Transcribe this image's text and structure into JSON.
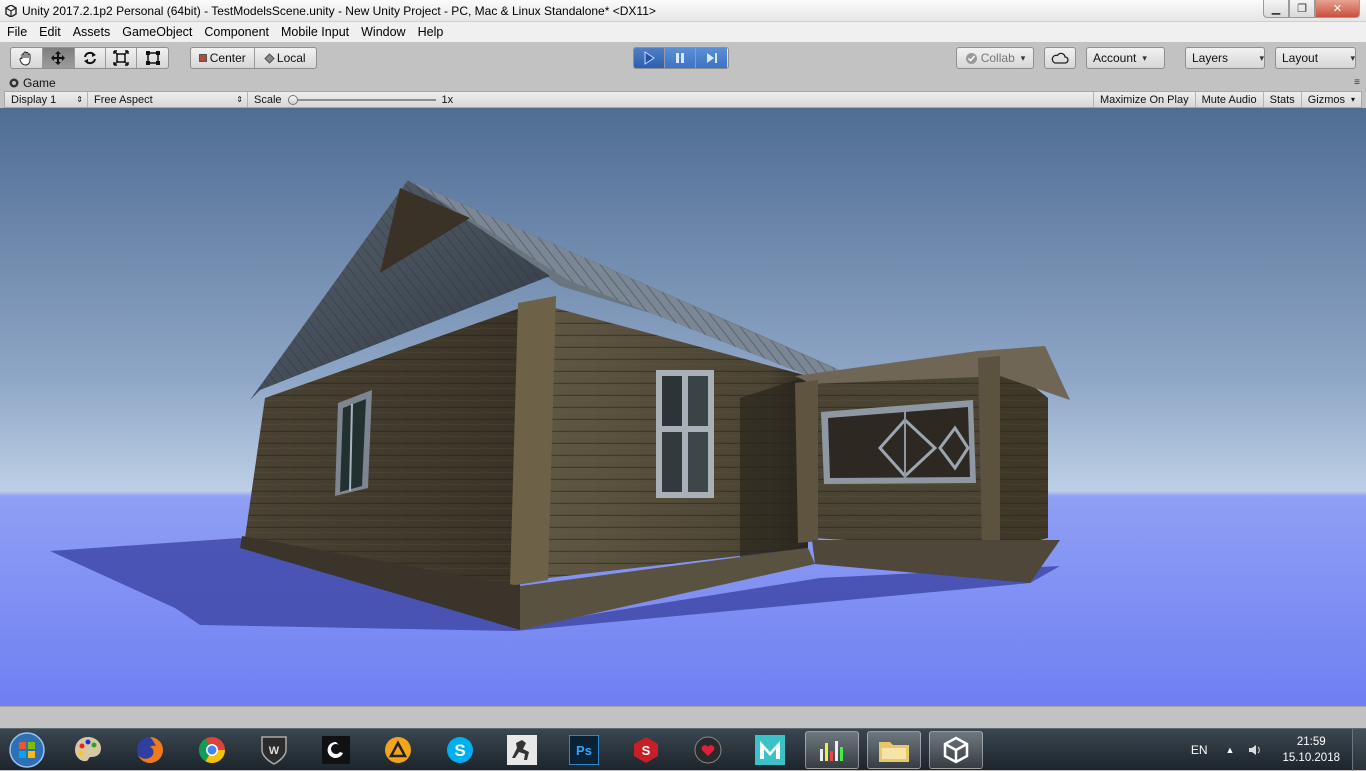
{
  "window": {
    "title": "Unity 2017.2.1p2 Personal (64bit) - TestModelsScene.unity - New Unity Project - PC, Mac & Linux Standalone* <DX11>"
  },
  "menu": [
    "File",
    "Edit",
    "Assets",
    "GameObject",
    "Component",
    "Mobile Input",
    "Window",
    "Help"
  ],
  "toolbar": {
    "pivot_label": "Center",
    "space_label": "Local",
    "collab_label": "Collab",
    "account_label": "Account",
    "layers_label": "Layers",
    "layout_label": "Layout"
  },
  "game_view": {
    "tab_label": "Game",
    "display_label": "Display 1",
    "aspect_label": "Free Aspect",
    "scale_label": "Scale",
    "scale_value": "1x",
    "maximize_label": "Maximize On Play",
    "mute_label": "Mute Audio",
    "stats_label": "Stats",
    "gizmos_label": "Gizmos"
  },
  "taskbar": {
    "apps": [
      "start-orb",
      "artrage",
      "firefox",
      "chrome",
      "world-of-tanks",
      "camtasia",
      "archicad",
      "skype",
      "zbrush",
      "photoshop",
      "substance-painter",
      "app-heart",
      "maya",
      "fl-studio",
      "file-explorer",
      "unity"
    ],
    "language": "EN",
    "time": "21:59",
    "date": "15.10.2018"
  }
}
